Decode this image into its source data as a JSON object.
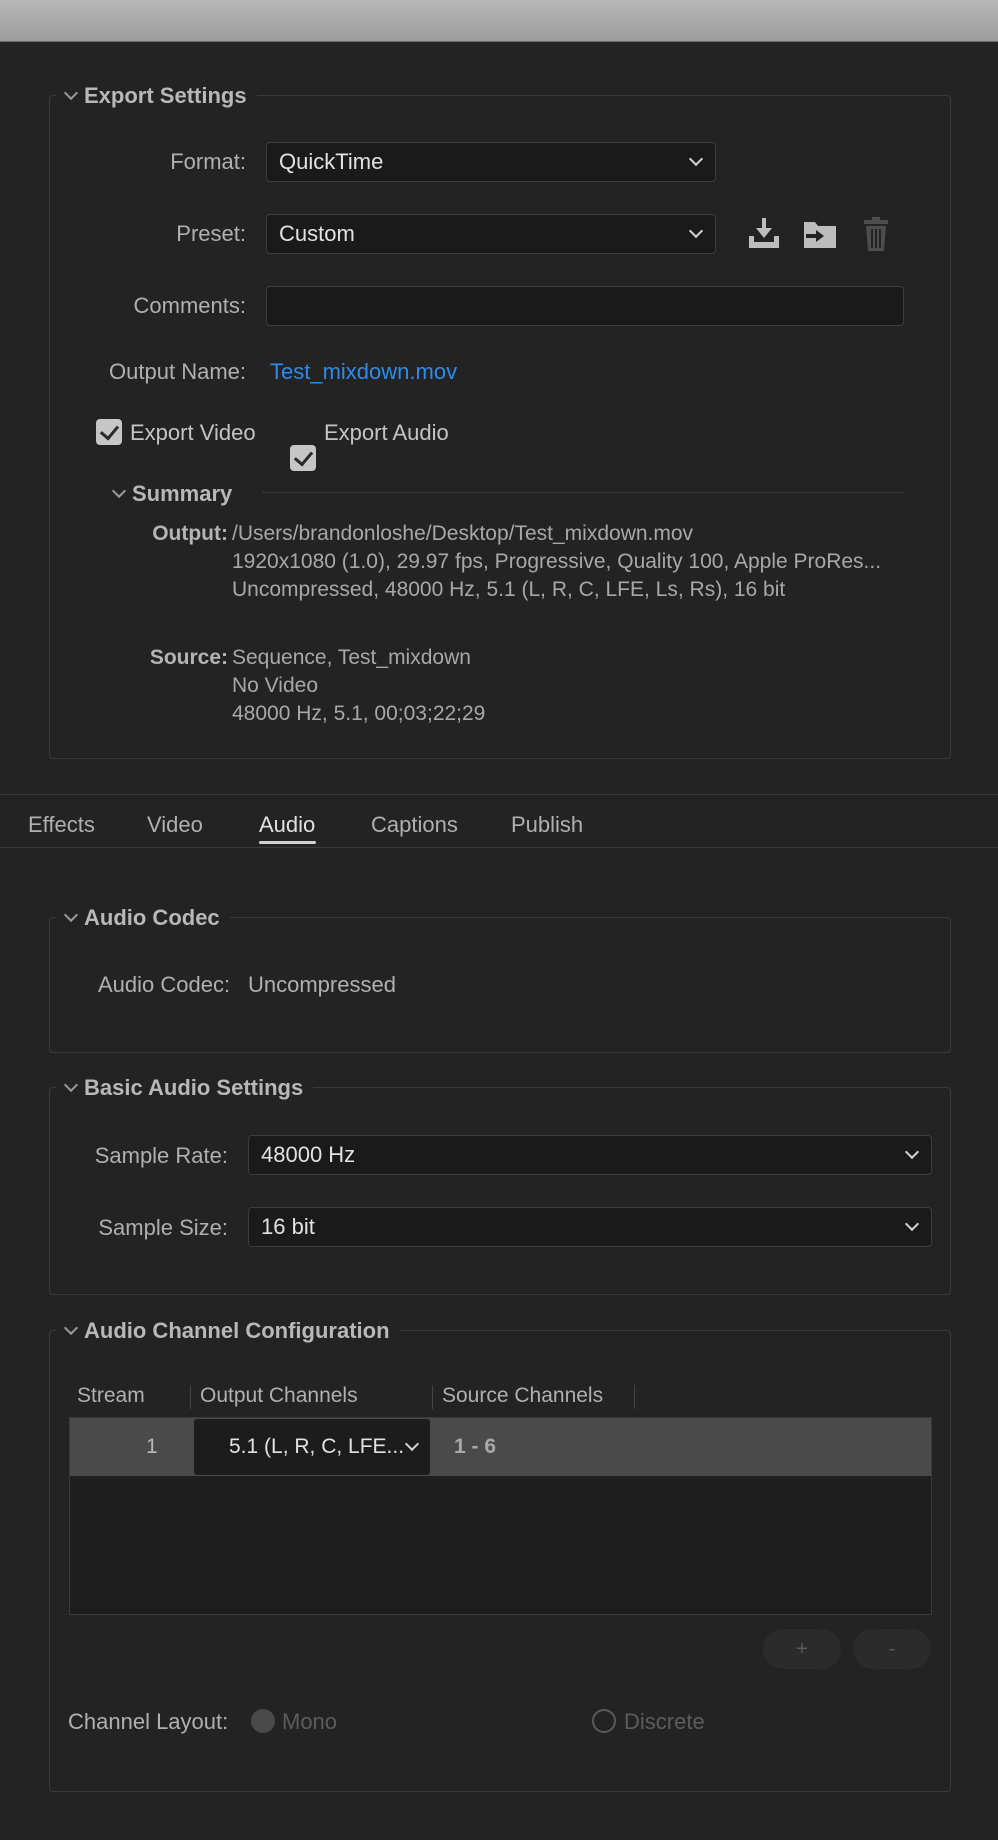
{
  "export_settings": {
    "title": "Export Settings",
    "format_label": "Format:",
    "format_value": "QuickTime",
    "preset_label": "Preset:",
    "preset_value": "Custom",
    "comments_label": "Comments:",
    "comments_value": "",
    "output_name_label": "Output Name:",
    "output_name_value": "Test_mixdown.mov",
    "export_video_label": "Export Video",
    "export_video_checked": true,
    "export_audio_label": "Export Audio",
    "export_audio_checked": true,
    "preset_icons": [
      "save-preset-icon",
      "import-preset-icon",
      "delete-preset-icon"
    ]
  },
  "summary": {
    "title": "Summary",
    "output_key": "Output:",
    "output_lines": [
      "/Users/brandonloshe/Desktop/Test_mixdown.mov",
      "1920x1080 (1.0), 29.97 fps, Progressive, Quality 100, Apple ProRes...",
      "Uncompressed, 48000 Hz, 5.1 (L, R, C, LFE, Ls, Rs), 16 bit"
    ],
    "source_key": "Source:",
    "source_lines": [
      "Sequence, Test_mixdown",
      "No Video",
      "48000 Hz, 5.1, 00;03;22;29"
    ]
  },
  "tabs": [
    {
      "label": "Effects",
      "active": false
    },
    {
      "label": "Video",
      "active": false
    },
    {
      "label": "Audio",
      "active": true
    },
    {
      "label": "Captions",
      "active": false
    },
    {
      "label": "Publish",
      "active": false
    }
  ],
  "audio_codec": {
    "title": "Audio Codec",
    "codec_label": "Audio Codec:",
    "codec_value": "Uncompressed"
  },
  "basic_audio": {
    "title": "Basic Audio Settings",
    "sample_rate_label": "Sample Rate:",
    "sample_rate_value": "48000 Hz",
    "sample_size_label": "Sample Size:",
    "sample_size_value": "16 bit"
  },
  "channel_config": {
    "title": "Audio Channel Configuration",
    "columns": [
      "Stream",
      "Output Channels",
      "Source Channels"
    ],
    "rows": [
      {
        "stream": "1",
        "output_channels": "5.1 (L, R, C, LFE...",
        "source_channels": "1 - 6"
      }
    ],
    "add_label": "+",
    "remove_label": "-",
    "channel_layout_label": "Channel Layout:",
    "layout_options": [
      {
        "label": "Mono",
        "selected": false,
        "enabled": false
      },
      {
        "label": "Discrete",
        "selected": false,
        "enabled": false
      }
    ]
  },
  "colors": {
    "background": "#232323",
    "link": "#2d8ceb",
    "field": "#1a1a1a"
  }
}
